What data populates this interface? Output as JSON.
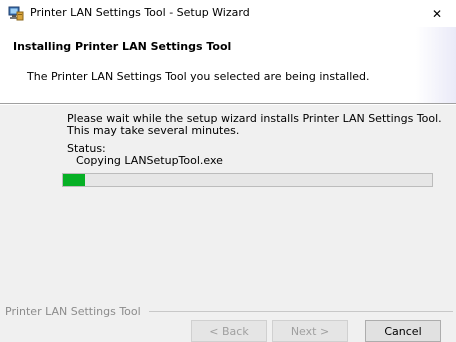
{
  "window": {
    "title": "Printer LAN Settings Tool - Setup Wizard",
    "icon": "installer-computer-icon",
    "close_glyph": "✕"
  },
  "header": {
    "title": "Installing Printer LAN Settings Tool",
    "description": "The Printer LAN Settings Tool you selected are being installed."
  },
  "body": {
    "wait_message": "Please wait while the setup wizard installs Printer LAN Settings Tool. This may take several minutes.",
    "status_label": "Status:",
    "status_value": "Copying LANSetupTool.exe",
    "progress_fraction": 0.06
  },
  "footer": {
    "brand": "Printer LAN Settings Tool",
    "back_label": "< Back",
    "next_label": "Next >",
    "cancel_label": "Cancel"
  },
  "colors": {
    "progress_fill": "#06b025",
    "background": "#f0f0f0"
  }
}
